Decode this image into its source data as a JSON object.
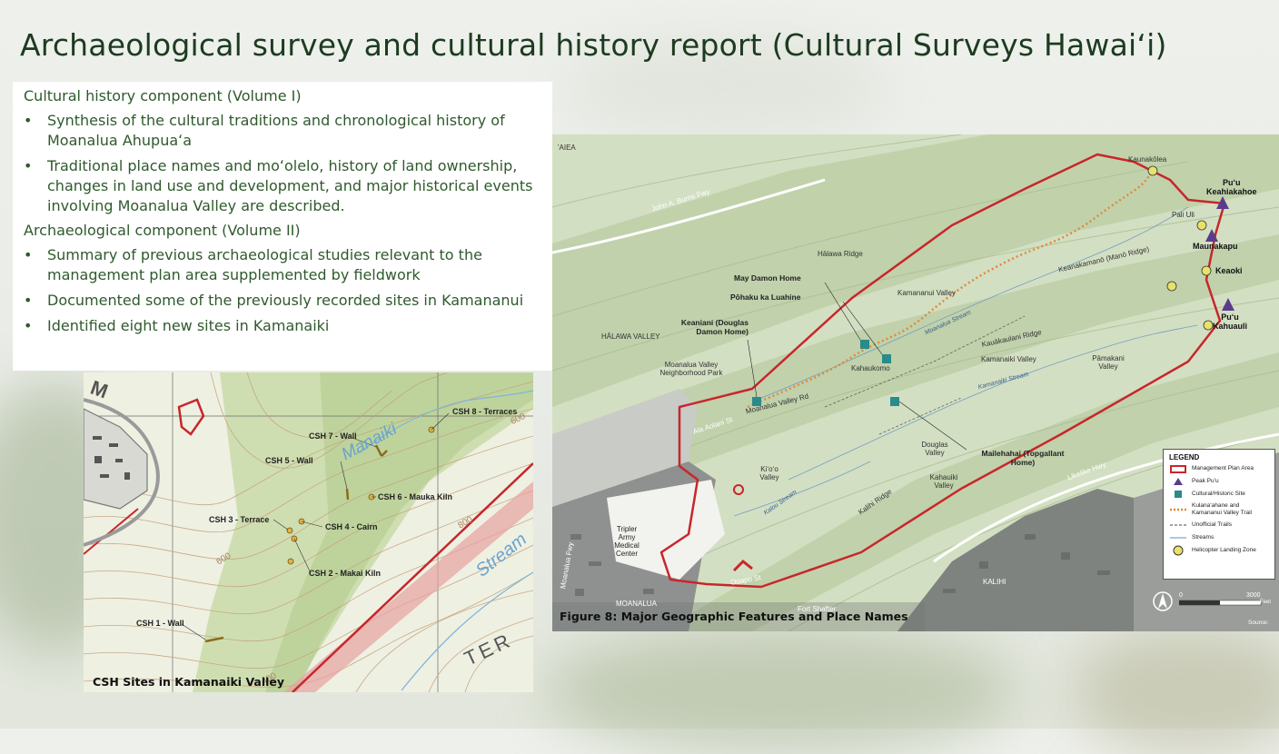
{
  "title": "Archaeological survey and cultural history report (Cultural Surveys Hawaiʻi)",
  "text_panel": {
    "sections": [
      {
        "heading": "Cultural history component (Volume I)",
        "bullets": [
          "Synthesis of the cultural traditions and chronological history of Moanalua Ahupuaʻa",
          "Traditional place names and moʻolelo, history of land ownership, changes in land use and development, and major historical events involving Moanalua Valley are described."
        ]
      },
      {
        "heading": "Archaeological component (Volume II)",
        "bullets": [
          "Summary of previous archaeological studies relevant to the management plan area supplemented by fieldwork",
          "Documented some of the previously recorded sites in Kamananui",
          "Identified eight new sites in Kamanaiki"
        ]
      }
    ],
    "bullet_char": "•"
  },
  "left_map": {
    "caption": "CSH Sites in Kamanaiki Valley",
    "sites": {
      "csh1": "CSH 1 - Wall",
      "csh2": "CSH 2 - Makai Kiln",
      "csh3": "CSH 3 - Terrace",
      "csh4": "CSH 4 - Cairn",
      "csh5": "CSH 5 - Wall",
      "csh6": "CSH 6 - Mauka Kiln",
      "csh7": "CSH 7 - Wall",
      "csh8": "CSH 8 - Terraces"
    },
    "map_text": {
      "stream_name": "Manaiki",
      "stream2": "Stream",
      "contour_600a": "600",
      "contour_600b": "600",
      "contour_400": "400",
      "contour_800": "800",
      "fter": "TER",
      "m_letter": "M"
    }
  },
  "right_map": {
    "caption": "Figure 8: Major Geographic Features and Place Names",
    "places": {
      "aiea": "'AIEA",
      "freeway": "John A. Burns Fwy",
      "halawa_ridge": "Hālawa Ridge",
      "halawa_valley": "HĀLAWA VALLEY",
      "may_damon": "May Damon Home",
      "pohaku": "Pōhaku ka Luahine",
      "keaniani": "Keaniani (Douglas Damon Home)",
      "park": "Moanalua Valley Neighborhood Park",
      "kahaukomo": "Kahaukomo",
      "kamananui_valley": "Kamananui Valley",
      "moanalua_stream": "Moanalua Stream",
      "keanakamano": "Keanakamanō (Manō Ridge)",
      "kaunakolea": "Kaunakōlea",
      "kauakaulani": "Kauākaulani Ridge",
      "kamanaiki_valley": "Kamanaiki Valley",
      "kamanaiki_stream": "Kamanaiki Stream",
      "pamakani": "Pāmakani Valley",
      "moanalua_rd": "Moanalua Valley Rd",
      "ala_aolani": "Ala Aolani St",
      "douglas_valley": "Douglas Valley",
      "mailehahai": "Mailehahai (Topgallant Home)",
      "kioo": "Kiʻoʻo Valley",
      "kalou": "Kalou Stream",
      "kahauiki_valley": "Kahauiki Valley",
      "kalihi_ridge": "Kalihi Ridge",
      "likelike": "Likelike Hwy",
      "tripler": "Tripler Army Medical Center",
      "moanalua_fwy": "Moanalua Fwy",
      "moanalua": "MOANALUA",
      "fort_shafter": "Fort Shafter",
      "kalihi": "KALIHI",
      "puuloa": "Pali Uli",
      "oahu_st": "Ooapo St"
    },
    "peaks": {
      "keahiakahoe_1": "Puʻu",
      "keahiakahoe_2": "Keahiakahoe",
      "maunakapu": "Maunakapu",
      "keaoki": "Keaoki",
      "kahuauli_1": "Puʻu",
      "kahuauli_2": "Kahuauli"
    },
    "legend": {
      "title": "LEGEND",
      "items": [
        "Management Plan Area",
        "Peak Puʻu",
        "Cultural/Historic Site",
        "Kulanaʻahane and Kamananui Valley Trail",
        "Unofficial Trails",
        "Streams",
        "Helicopter Landing Zone"
      ]
    },
    "scale": {
      "start": "0",
      "end": "3000",
      "unit": "Feet"
    },
    "source": "Source:",
    "colors": {
      "boundary": "#c8262b",
      "trail": "#e08a3a",
      "peak": "#5b3c8c",
      "site": "#2b8a8a",
      "helipad": "#e9e26a"
    }
  }
}
